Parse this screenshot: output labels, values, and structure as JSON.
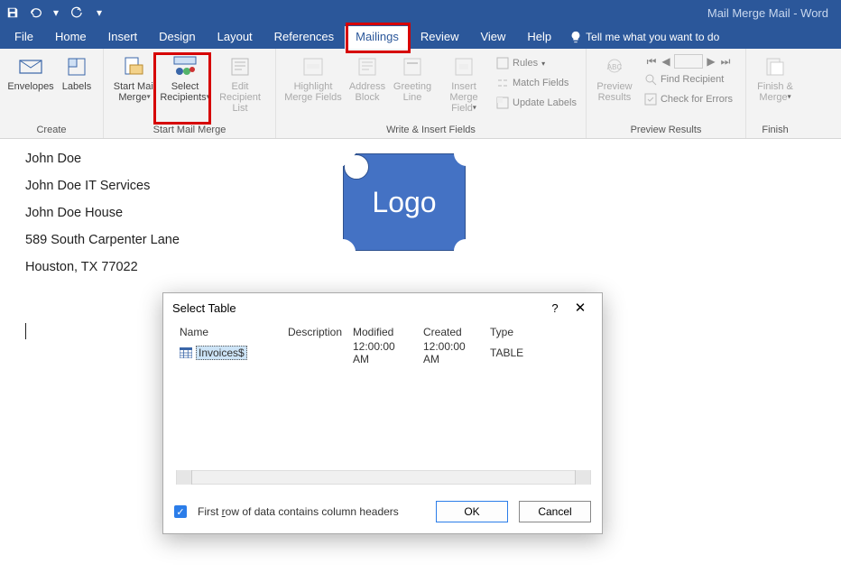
{
  "window": {
    "title": "Mail Merge Mail  -  Word"
  },
  "tabs": {
    "file": "File",
    "home": "Home",
    "insert": "Insert",
    "design": "Design",
    "layout": "Layout",
    "references": "References",
    "mailings": "Mailings",
    "review": "Review",
    "view": "View",
    "help": "Help",
    "tellme": "Tell me what you want to do"
  },
  "ribbon": {
    "create": {
      "envelopes": "Envelopes",
      "labels": "Labels",
      "group": "Create"
    },
    "startmm": {
      "start": "Start Mail Merge",
      "select": "Select Recipients",
      "edit": "Edit Recipient List",
      "group": "Start Mail Merge"
    },
    "write": {
      "highlight": "Highlight Merge Fields",
      "address": "Address Block",
      "greeting": "Greeting Line",
      "insertfield": "Insert Merge Field",
      "rules": "Rules",
      "match": "Match Fields",
      "update": "Update Labels",
      "group": "Write & Insert Fields"
    },
    "preview": {
      "preview": "Preview Results",
      "find": "Find Recipient",
      "check": "Check for Errors",
      "group": "Preview Results"
    },
    "finish": {
      "finish": "Finish & Merge",
      "group": "Finish"
    }
  },
  "document": {
    "line1": "John Doe",
    "line2": "John Doe IT Services",
    "line3": "John Doe House",
    "line4": "589 South Carpenter Lane",
    "line5": "Houston, TX 77022",
    "logo": "Logo"
  },
  "dialog": {
    "title": "Select Table",
    "columns": {
      "name": "Name",
      "description": "Description",
      "modified": "Modified",
      "created": "Created",
      "type": "Type"
    },
    "row": {
      "name": "Invoices$",
      "description": "",
      "modified": "12:00:00 AM",
      "created": "12:00:00 AM",
      "type": "TABLE"
    },
    "checkbox_pre": "First ",
    "checkbox_ul": "r",
    "checkbox_post": "ow of data contains column headers",
    "ok": "OK",
    "cancel": "Cancel",
    "help": "?",
    "close": "✕"
  }
}
